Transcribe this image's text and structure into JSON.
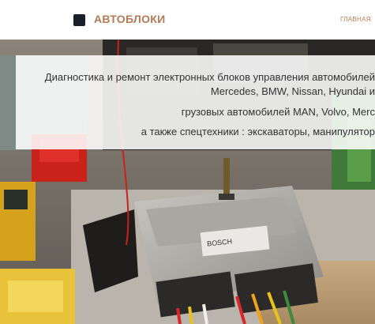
{
  "header": {
    "logo_icon": "square-logo-icon",
    "brand": "АВТОБЛОКИ",
    "nav_home": "ГЛАВНАЯ"
  },
  "hero": {
    "line1": "Диагностика и ремонт электронных блоков управления автомобилей",
    "line2": "Mercedes, BMW, Nissan, Hyundai и",
    "line3": "грузовых автомобилей MAN, Volvo, Merc",
    "line4": "а также спецтехники : экскаваторы, манипулятор",
    "ecu_label": "BOSCH"
  },
  "colors": {
    "brand": "#b37a55",
    "logo_mark": "#1a1f2b"
  }
}
